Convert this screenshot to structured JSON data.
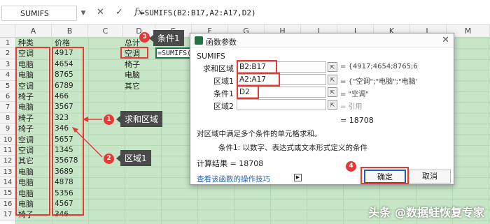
{
  "formula_bar": {
    "name_box": "SUMIFS",
    "cancel_icon": "close-icon",
    "confirm_icon": "check-icon",
    "fx_label": "fx",
    "formula": "=SUMIFS(B2:B17,A2:A17,D2)"
  },
  "columns": [
    "A",
    "B",
    "C",
    "D",
    "E",
    "F",
    "G",
    "H",
    "I",
    "J",
    "K",
    "L",
    "M"
  ],
  "rows": [
    "1",
    "2",
    "3",
    "4",
    "5",
    "6",
    "7",
    "8",
    "9",
    "10",
    "11",
    "12",
    "13",
    "14",
    "15",
    "16",
    "17"
  ],
  "table": {
    "header_a": "种类",
    "header_b": "价格",
    "categories": [
      "空调",
      "电脑",
      "电脑",
      "空调",
      "椅子",
      "电脑",
      "椅子",
      "椅子",
      "空调",
      "空调",
      "其它",
      "电脑",
      "电脑",
      "电脑",
      "电脑",
      "椅子"
    ],
    "prices": [
      "4917",
      "4654",
      "8765",
      "6789",
      "466",
      "3567",
      "323",
      "346",
      "5657",
      "1345",
      "35678",
      "3689",
      "4878",
      "5356",
      "4567",
      "346"
    ]
  },
  "summary": {
    "header": "总计",
    "items": [
      "空调",
      "椅子",
      "电脑",
      "其它"
    ],
    "selected_cell_text": "=SUMIFS(B"
  },
  "callouts": [
    {
      "num": "1",
      "label": "求和区域"
    },
    {
      "num": "2",
      "label": "区域1"
    },
    {
      "num": "3",
      "label": "条件1"
    },
    {
      "num": "4",
      "label": ""
    }
  ],
  "dialog": {
    "title": "函数参数",
    "function_name": "SUMIFS",
    "args": [
      {
        "label": "求和区域",
        "value": "B2:B17",
        "result": "= {4917;4654;8765;6789;466;35..."
      },
      {
        "label": "区域1",
        "value": "A2:A17",
        "result": "= {\"空调\";\"电脑\";\"电脑\";\"空调\";\"..."
      },
      {
        "label": "条件1",
        "value": "D2",
        "result": "= \"空调\""
      },
      {
        "label": "区域2",
        "value": "",
        "result": "= 引用"
      }
    ],
    "total": "= 18708",
    "description": "对区域中满足多个条件的单元格求和。",
    "arg_description": "条件1:  以数字、表达式或文本形式定义的条件",
    "calc_result": "计算结果 = 18708",
    "help_link": "查看该函数的操作技巧",
    "ok_label": "确定",
    "cancel_label": "取消"
  },
  "watermark": "头条 @数据蛙恢复专家",
  "colors": {
    "sheet_bg": "#c7e6c7",
    "highlight_red": "#e53935",
    "excel_green": "#217346",
    "callout_dark": "#4a4a4a"
  }
}
